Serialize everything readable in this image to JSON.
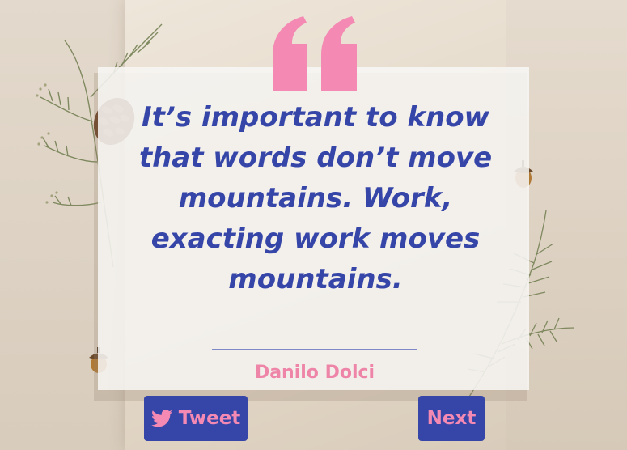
{
  "quote": {
    "text": "It’s important to know that words don’t move mountains. Work, exacting work moves mountains.",
    "author": "Danilo Dolci"
  },
  "actions": {
    "tweet_label": "Tweet",
    "next_label": "Next"
  },
  "colors": {
    "accent_blue": "#3646a8",
    "accent_pink": "#f48ab3",
    "card_bg": "#f8f7f5",
    "page_bg": "#e6ddd1"
  },
  "icons": {
    "quote_mark": "quote-icon",
    "tweet": "twitter-bird-icon"
  }
}
